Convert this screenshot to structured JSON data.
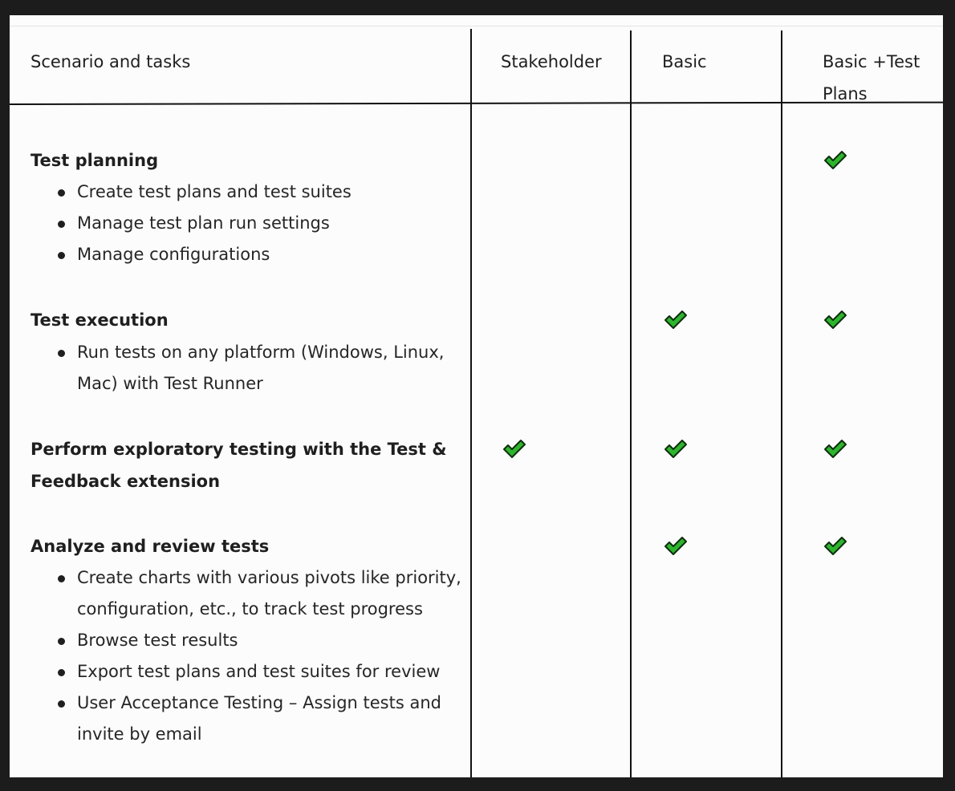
{
  "header": {
    "scenario": "Scenario and tasks",
    "stakeholder": "Stakeholder",
    "basic": "Basic",
    "basic_test_plans": "Basic +Test Plans"
  },
  "rows": [
    {
      "title": "Test planning",
      "tasks": [
        "Create test plans and test suites",
        "Manage test plan run settings",
        "Manage configurations"
      ],
      "stakeholder": false,
      "basic": false,
      "basic_test_plans": true
    },
    {
      "title": "Test execution",
      "tasks": [
        "Run tests on any platform (Windows, Linux, Mac) with Test Runner"
      ],
      "stakeholder": false,
      "basic": true,
      "basic_test_plans": true
    },
    {
      "title": "Perform exploratory testing with the Test & Feedback extension",
      "tasks": [],
      "stakeholder": true,
      "basic": true,
      "basic_test_plans": true
    },
    {
      "title": "Analyze and review tests",
      "tasks": [
        "Create charts with various pivots like priority, configuration, etc., to track test progress",
        "Browse test results",
        "Export test plans and test suites for review",
        "User Acceptance Testing – Assign tests and invite by email"
      ],
      "stakeholder": false,
      "basic": true,
      "basic_test_plans": true
    }
  ],
  "icons": {
    "check": "checkmark-icon"
  },
  "colors": {
    "check_fill": "#2db52d",
    "check_stroke": "#0e2e0e"
  }
}
